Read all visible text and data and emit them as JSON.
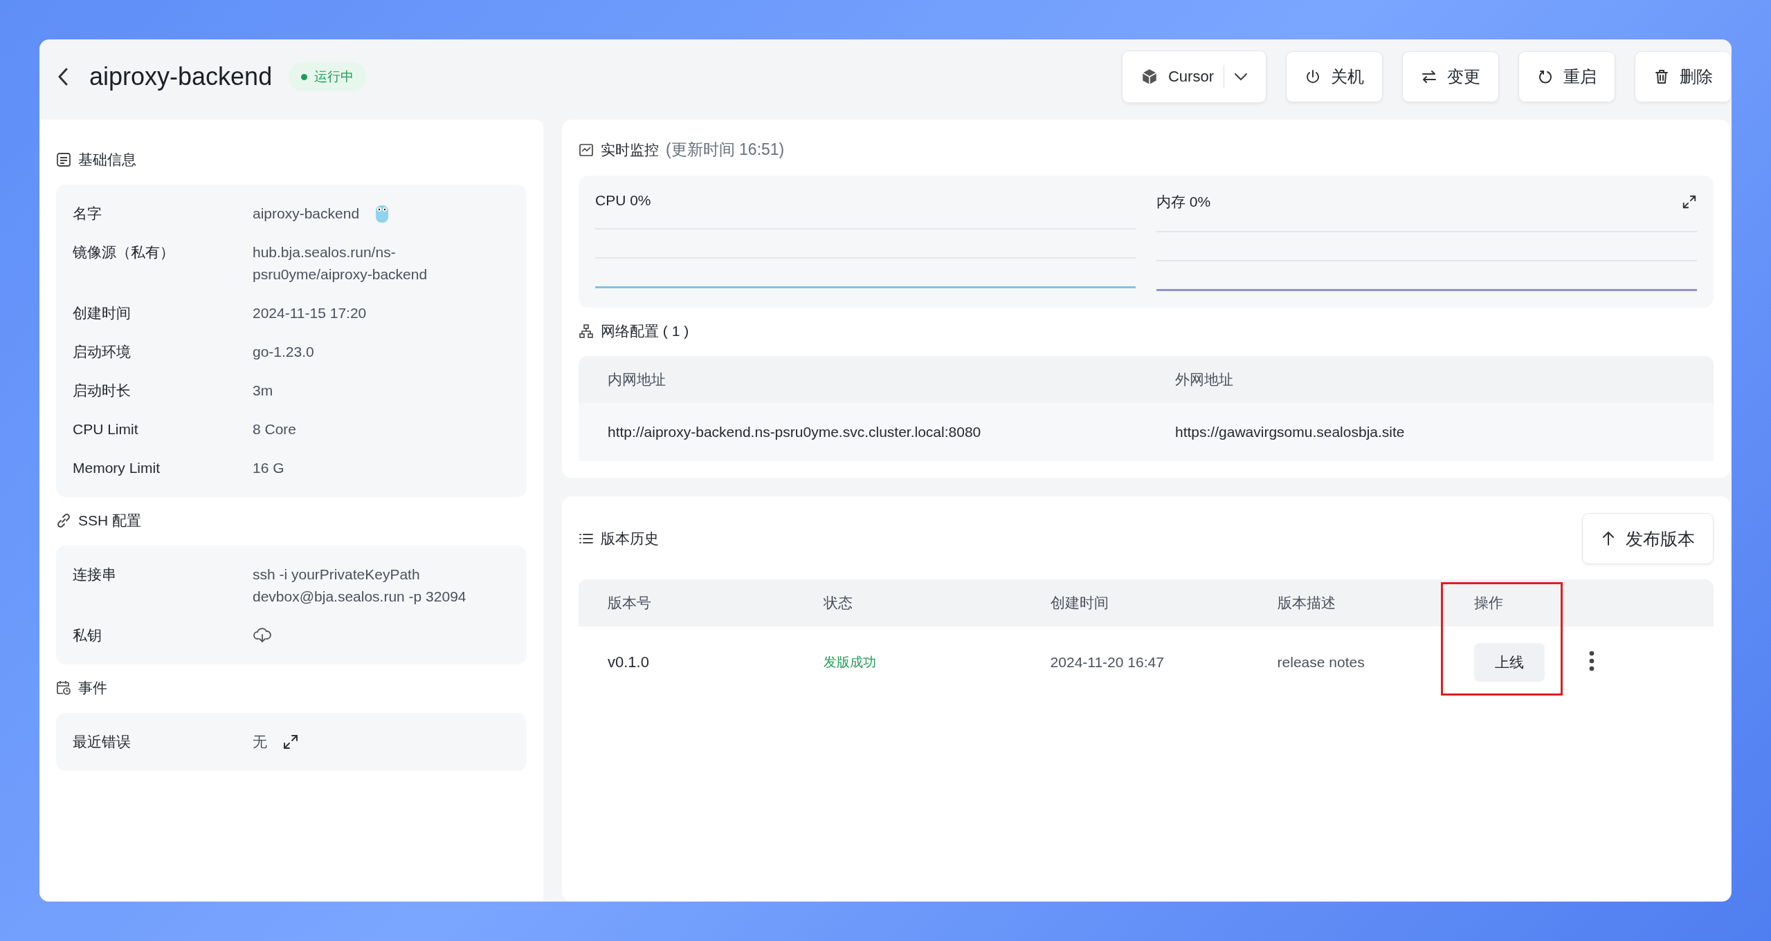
{
  "header": {
    "title": "aiproxy-backend",
    "status": "运行中",
    "ide": "Cursor",
    "actions": [
      {
        "label": "关机",
        "kind": "power"
      },
      {
        "label": "变更",
        "kind": "swap"
      },
      {
        "label": "重启",
        "kind": "restart"
      },
      {
        "label": "删除",
        "kind": "delete"
      }
    ]
  },
  "basic": {
    "title": "基础信息",
    "rows": [
      {
        "label": "名字",
        "value": "aiproxy-backend",
        "kind": "name"
      },
      {
        "label": "镜像源（私有）",
        "value": "hub.bja.sealos.run/ns-psru0yme/aiproxy-backend",
        "kind": "text"
      },
      {
        "label": "创建时间",
        "value": "2024-11-15 17:20",
        "kind": "text"
      },
      {
        "label": "启动环境",
        "value": "go-1.23.0",
        "kind": "text"
      },
      {
        "label": "启动时长",
        "value": "3m",
        "kind": "text"
      },
      {
        "label": "CPU Limit",
        "value": "8 Core",
        "kind": "text"
      },
      {
        "label": "Memory Limit",
        "value": "16 G",
        "kind": "text"
      }
    ]
  },
  "ssh": {
    "title": "SSH 配置",
    "rows": [
      {
        "label": "连接串",
        "value": "ssh -i yourPrivateKeyPath devbox@bja.sealos.run -p 32094",
        "kind": "text"
      },
      {
        "label": "私钥",
        "kind": "download"
      }
    ]
  },
  "events": {
    "title": "事件",
    "rows": [
      {
        "label": "最近错误",
        "value": "无",
        "kind": "expand"
      }
    ]
  },
  "monitor": {
    "title": "实时监控",
    "update": "(更新时间  16:51)",
    "metrics": [
      {
        "label": "CPU 0%",
        "color": "#7cc4ea"
      },
      {
        "label": "内存 0%",
        "color": "#8f92c8"
      }
    ]
  },
  "network": {
    "title": "网络配置 ( 1 )",
    "columns": [
      "内网地址",
      "外网地址"
    ],
    "rows": [
      [
        "http://aiproxy-backend.ns-psru0yme.svc.cluster.local:8080",
        "https://gawavirgsomu.sealosbja.site"
      ]
    ]
  },
  "versions": {
    "title": "版本历史",
    "publish": "发布版本",
    "columns": [
      "版本号",
      "状态",
      "创建时间",
      "版本描述",
      "操作"
    ],
    "rows": [
      {
        "version": "v0.1.0",
        "status": "发版成功",
        "created": "2024-11-20 16:47",
        "notes": "release notes",
        "action": "上线"
      }
    ]
  }
}
